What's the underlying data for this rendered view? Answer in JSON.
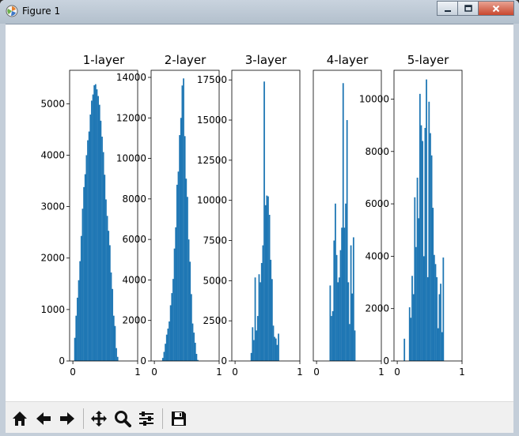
{
  "window": {
    "title": "Figure 1"
  },
  "toolbar": {
    "buttons": [
      {
        "name": "home-button",
        "icon": "home-icon"
      },
      {
        "name": "back-button",
        "icon": "arrow-left-icon"
      },
      {
        "name": "forward-button",
        "icon": "arrow-right-icon"
      },
      {
        "name": "pan-button",
        "icon": "move-icon"
      },
      {
        "name": "zoom-button",
        "icon": "magnifier-icon"
      },
      {
        "name": "configure-subplots-button",
        "icon": "sliders-icon"
      },
      {
        "name": "save-button",
        "icon": "floppy-icon"
      }
    ]
  },
  "chart_data": [
    {
      "type": "bar",
      "title": "1-layer",
      "bar_color": "#1f77b4",
      "xlim": [
        -0.05,
        1.0
      ],
      "ylim": [
        0,
        5650
      ],
      "xticks": [
        0,
        1
      ],
      "xtick_labels": [
        "0",
        "1"
      ],
      "yticks": [
        0,
        1000,
        2000,
        3000,
        4000,
        5000
      ],
      "ytick_labels": [
        "0",
        "1000",
        "2000",
        "3000",
        "4000",
        "5000"
      ],
      "bins": [
        [
          0.02,
          450
        ],
        [
          0.04,
          880
        ],
        [
          0.06,
          1230
        ],
        [
          0.08,
          1570
        ],
        [
          0.1,
          1940
        ],
        [
          0.12,
          2430
        ],
        [
          0.14,
          2960
        ],
        [
          0.16,
          3380
        ],
        [
          0.18,
          3630
        ],
        [
          0.2,
          4000
        ],
        [
          0.22,
          4290
        ],
        [
          0.24,
          4460
        ],
        [
          0.26,
          4790
        ],
        [
          0.28,
          5060
        ],
        [
          0.3,
          5180
        ],
        [
          0.32,
          5360
        ],
        [
          0.34,
          5380
        ],
        [
          0.36,
          5280
        ],
        [
          0.38,
          5150
        ],
        [
          0.4,
          4980
        ],
        [
          0.42,
          4670
        ],
        [
          0.44,
          4360
        ],
        [
          0.46,
          4060
        ],
        [
          0.48,
          3620
        ],
        [
          0.5,
          3140
        ],
        [
          0.52,
          2820
        ],
        [
          0.54,
          2530
        ],
        [
          0.56,
          2250
        ],
        [
          0.58,
          1720
        ],
        [
          0.6,
          1400
        ],
        [
          0.62,
          880
        ],
        [
          0.64,
          680
        ],
        [
          0.66,
          250
        ],
        [
          0.68,
          80
        ]
      ]
    },
    {
      "type": "bar",
      "title": "2-layer",
      "bar_color": "#1f77b4",
      "xlim": [
        -0.05,
        1.0
      ],
      "ylim": [
        0,
        14350
      ],
      "xticks": [
        0,
        1
      ],
      "xtick_labels": [
        "0",
        "1"
      ],
      "yticks": [
        0,
        2000,
        4000,
        6000,
        8000,
        10000,
        12000,
        14000
      ],
      "ytick_labels": [
        "0",
        "2000",
        "4000",
        "6000",
        "8000",
        "10000",
        "12000",
        "14000"
      ],
      "bins": [
        [
          0.12,
          150
        ],
        [
          0.14,
          450
        ],
        [
          0.16,
          850
        ],
        [
          0.18,
          1300
        ],
        [
          0.2,
          1600
        ],
        [
          0.22,
          1950
        ],
        [
          0.24,
          2750
        ],
        [
          0.26,
          3350
        ],
        [
          0.28,
          4050
        ],
        [
          0.3,
          5550
        ],
        [
          0.32,
          6600
        ],
        [
          0.34,
          8700
        ],
        [
          0.36,
          9350
        ],
        [
          0.38,
          11150
        ],
        [
          0.4,
          12000
        ],
        [
          0.42,
          13600
        ],
        [
          0.44,
          13950
        ],
        [
          0.46,
          11100
        ],
        [
          0.48,
          9000
        ],
        [
          0.5,
          8100
        ],
        [
          0.52,
          6000
        ],
        [
          0.54,
          4900
        ],
        [
          0.56,
          3300
        ],
        [
          0.58,
          1850
        ],
        [
          0.6,
          1400
        ],
        [
          0.62,
          900
        ],
        [
          0.64,
          350
        ],
        [
          0.66,
          50
        ]
      ]
    },
    {
      "type": "bar",
      "title": "3-layer",
      "bar_color": "#1f77b4",
      "xlim": [
        -0.05,
        1.0
      ],
      "ylim": [
        0,
        18100
      ],
      "xticks": [
        0,
        1
      ],
      "xtick_labels": [
        "0",
        "1"
      ],
      "yticks": [
        0,
        2500,
        5000,
        7500,
        10000,
        12500,
        15000,
        17500
      ],
      "ytick_labels": [
        "0",
        "2500",
        "5000",
        "7500",
        "10000",
        "12500",
        "15000",
        "17500"
      ],
      "bins": [
        [
          0.24,
          500
        ],
        [
          0.26,
          2100
        ],
        [
          0.28,
          1300
        ],
        [
          0.3,
          5200
        ],
        [
          0.32,
          1900
        ],
        [
          0.34,
          2800
        ],
        [
          0.36,
          5400
        ],
        [
          0.38,
          4900
        ],
        [
          0.4,
          6100
        ],
        [
          0.42,
          7200
        ],
        [
          0.44,
          17400
        ],
        [
          0.46,
          9700
        ],
        [
          0.48,
          10300
        ],
        [
          0.5,
          10250
        ],
        [
          0.52,
          9100
        ],
        [
          0.54,
          6300
        ],
        [
          0.56,
          5100
        ],
        [
          0.58,
          2200
        ],
        [
          0.6,
          1500
        ],
        [
          0.62,
          1400
        ],
        [
          0.64,
          1000
        ],
        [
          0.66,
          1700
        ]
      ]
    },
    {
      "type": "bar",
      "title": "4-layer",
      "bar_color": "#1f77b4",
      "xlim": [
        -0.05,
        1.0
      ],
      "ylim": [
        0,
        18100
      ],
      "xticks": [
        0,
        1
      ],
      "xtick_labels": [
        "0",
        "1"
      ],
      "yticks": [],
      "ytick_labels": [],
      "bins": [
        [
          0.2,
          4700
        ],
        [
          0.22,
          2800
        ],
        [
          0.24,
          3100
        ],
        [
          0.26,
          7500
        ],
        [
          0.28,
          9800
        ],
        [
          0.3,
          6600
        ],
        [
          0.32,
          4900
        ],
        [
          0.34,
          5200
        ],
        [
          0.36,
          6900
        ],
        [
          0.38,
          8300
        ],
        [
          0.4,
          17300
        ],
        [
          0.42,
          8300
        ],
        [
          0.44,
          9800
        ],
        [
          0.46,
          15000
        ],
        [
          0.48,
          4900
        ],
        [
          0.5,
          2300
        ],
        [
          0.52,
          7200
        ],
        [
          0.54,
          4200
        ],
        [
          0.56,
          7700
        ],
        [
          0.58,
          1900
        ]
      ]
    },
    {
      "type": "bar",
      "title": "5-layer",
      "bar_color": "#1f77b4",
      "xlim": [
        -0.05,
        1.0
      ],
      "ylim": [
        0,
        11100
      ],
      "xticks": [
        0,
        1
      ],
      "xtick_labels": [
        "0",
        "1"
      ],
      "yticks": [
        0,
        2000,
        4000,
        6000,
        8000,
        10000
      ],
      "ytick_labels": [
        "0",
        "2000",
        "4000",
        "6000",
        "8000",
        "10000"
      ],
      "bins": [
        [
          0.1,
          850
        ],
        [
          0.18,
          2050
        ],
        [
          0.2,
          1650
        ],
        [
          0.22,
          3250
        ],
        [
          0.24,
          2550
        ],
        [
          0.26,
          6250
        ],
        [
          0.28,
          4350
        ],
        [
          0.3,
          7000
        ],
        [
          0.32,
          5450
        ],
        [
          0.34,
          10200
        ],
        [
          0.36,
          9000
        ],
        [
          0.38,
          8400
        ],
        [
          0.4,
          4000
        ],
        [
          0.42,
          8900
        ],
        [
          0.44,
          10750
        ],
        [
          0.46,
          3200
        ],
        [
          0.48,
          9900
        ],
        [
          0.5,
          8700
        ],
        [
          0.52,
          7850
        ],
        [
          0.54,
          5850
        ],
        [
          0.56,
          4050
        ],
        [
          0.58,
          3700
        ],
        [
          0.6,
          3200
        ],
        [
          0.62,
          1250
        ],
        [
          0.64,
          2550
        ],
        [
          0.66,
          2950
        ],
        [
          0.68,
          1100
        ],
        [
          0.7,
          3950
        ]
      ]
    }
  ]
}
